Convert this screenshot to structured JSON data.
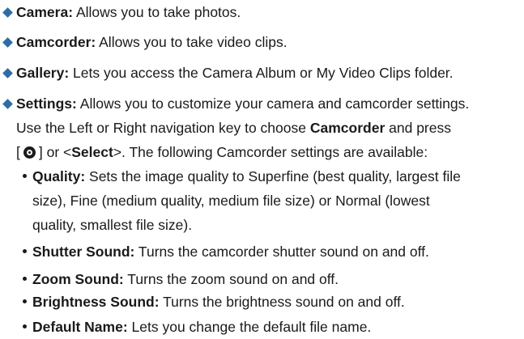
{
  "colors": {
    "bullet": "#2e6da4",
    "text": "#1a1a1a"
  },
  "items": [
    {
      "term": "Camera:",
      "text": " Allows you to take photos."
    },
    {
      "term": "Camcorder:",
      "text": " Allows you to take video clips."
    },
    {
      "term": "Gallery:",
      "text": " Lets you access the Camera Album or My Video Clips folder."
    },
    {
      "term": "Settings:",
      "text": " Allows you to customize your camera and camcorder settings.",
      "line2_pre": "Use the Left or Right navigation key to choose ",
      "line2_bold": "Camcorder",
      "line2_post": " and press",
      "line3_open": "[",
      "key_icon": "ok-key-icon",
      "line3_mid": "] or <",
      "line3_bold": "Select",
      "line3_post": ">. The following Camcorder settings are available:"
    }
  ],
  "settings": [
    {
      "term": "Quality:",
      "text": " Sets the image quality to Superfine (best quality, largest file",
      "line2": "size), Fine (medium quality, medium file size) or Normal (lowest",
      "line3": "quality, smallest file size)."
    },
    {
      "term": "Shutter Sound:",
      "text": " Turns the camcorder shutter sound on and off."
    },
    {
      "term": "Zoom Sound:",
      "text": " Turns the zoom sound on and off."
    },
    {
      "term": "Brightness Sound:",
      "text": " Turns the brightness sound on and off."
    },
    {
      "term": "Default Name:",
      "text": " Lets you change the default file name."
    }
  ]
}
